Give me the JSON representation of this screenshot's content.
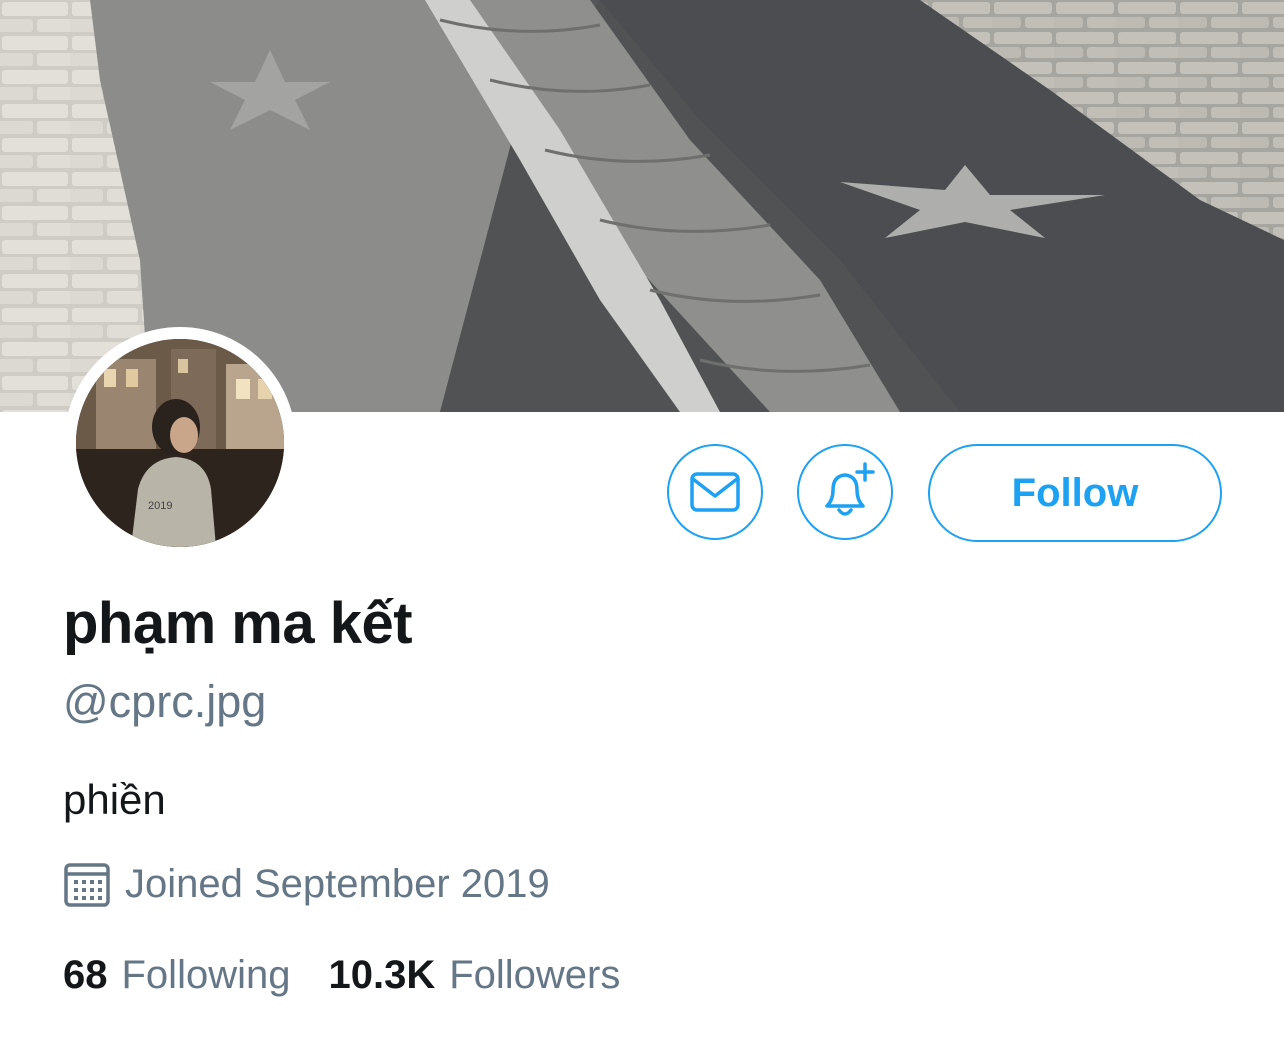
{
  "profile": {
    "display_name": "phạm ma kết",
    "handle": "@cprc.jpg",
    "bio": "phiền",
    "joined": "Joined September 2019",
    "avatar_jacket_text": "2019"
  },
  "actions": {
    "follow_label": "Follow",
    "message_icon": "envelope-icon",
    "notify_icon": "bell-plus-icon"
  },
  "stats": {
    "following_count": "68",
    "following_label": "Following",
    "followers_count": "10.3K",
    "followers_label": "Followers"
  },
  "colors": {
    "accent": "#1da1f2",
    "secondary_text": "#657786",
    "primary_text": "#14171a"
  }
}
